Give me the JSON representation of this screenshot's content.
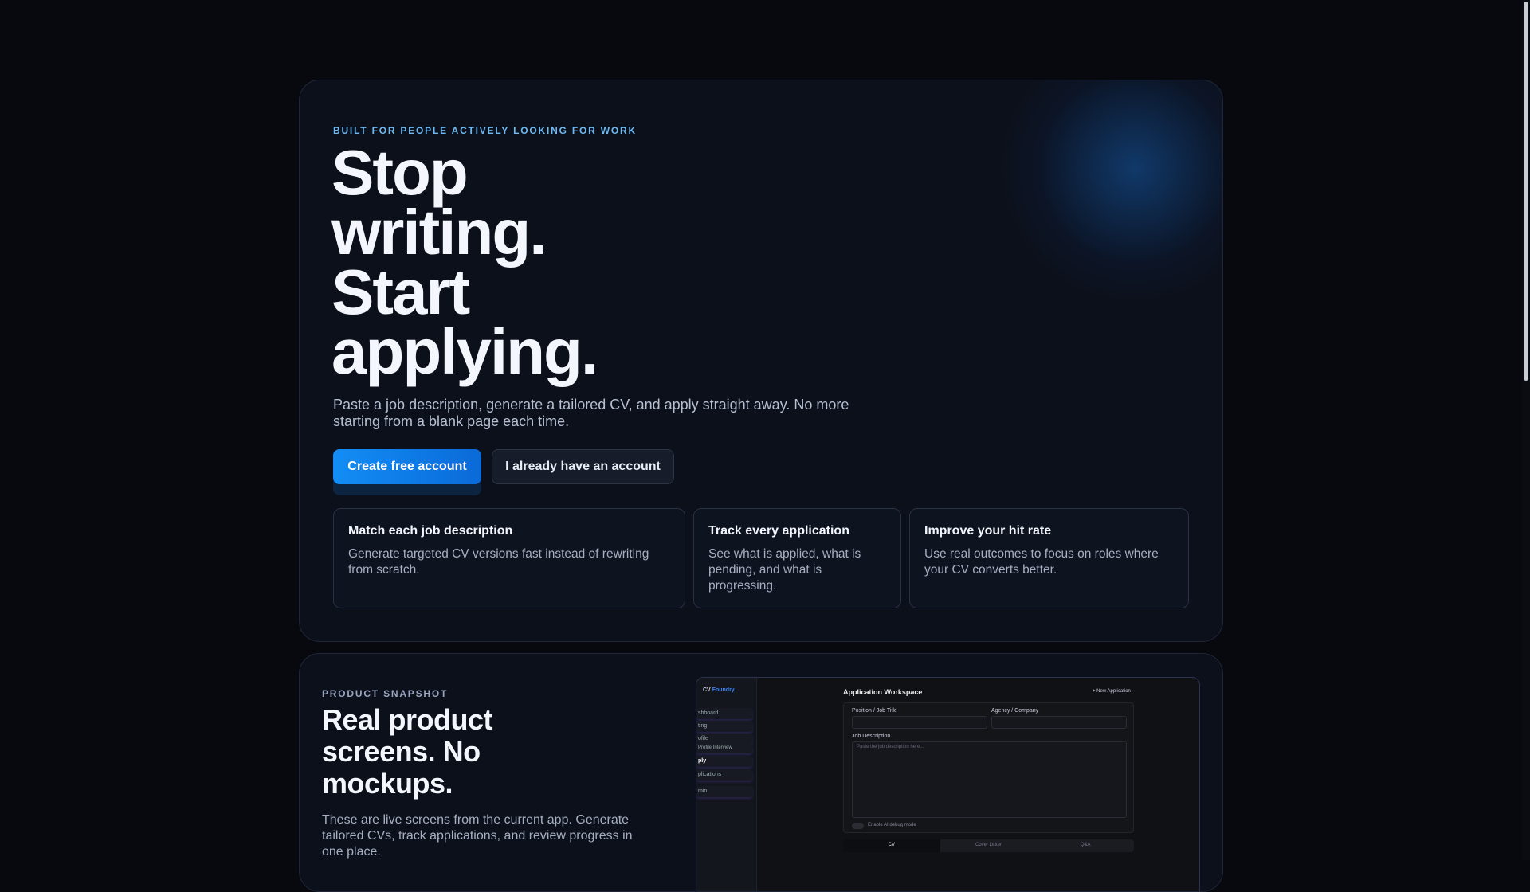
{
  "hero": {
    "eyebrow": "BUILT FOR PEOPLE ACTIVELY LOOKING FOR WORK",
    "title_lines": [
      "Stop",
      "writing.",
      "Start",
      "applying."
    ],
    "description": "Paste a job description, generate a tailored CV, and apply straight away. No more starting from a blank page each time.",
    "primary_cta": "Create free account",
    "secondary_cta": "I already have an account",
    "features": [
      {
        "title": "Match each job description",
        "text": "Generate targeted CV versions fast instead of rewriting from scratch."
      },
      {
        "title": "Track every application",
        "text": "See what is applied, what is pending, and what is progressing."
      },
      {
        "title": "Improve your hit rate",
        "text": "Use real outcomes to focus on roles where your CV converts better."
      }
    ]
  },
  "snapshot": {
    "eyebrow": "PRODUCT SNAPSHOT",
    "title": "Real product screens. No mockups.",
    "description": "These are live screens from the current app. Generate tailored CVs, track applications, and review progress in one place.",
    "screen": {
      "brand_a": "CV",
      "brand_b": "Foundry",
      "nav": [
        "shboard",
        "ting",
        "ofile",
        "Profile Interview",
        "ply",
        "plications",
        "min"
      ],
      "title": "Application Workspace",
      "new_app": "+ New Application",
      "position_label": "Position / Job Title",
      "company_label": "Agency / Company",
      "jd_label": "Job Description",
      "jd_placeholder": "Paste the job description here...",
      "debug_label": "Enable AI debug mode",
      "tabs": [
        "CV",
        "Cover Letter",
        "Q&A"
      ]
    }
  },
  "colors": {
    "accent": "#138df5",
    "eyebrow": "#6fbaf2",
    "background": "#07090f"
  }
}
